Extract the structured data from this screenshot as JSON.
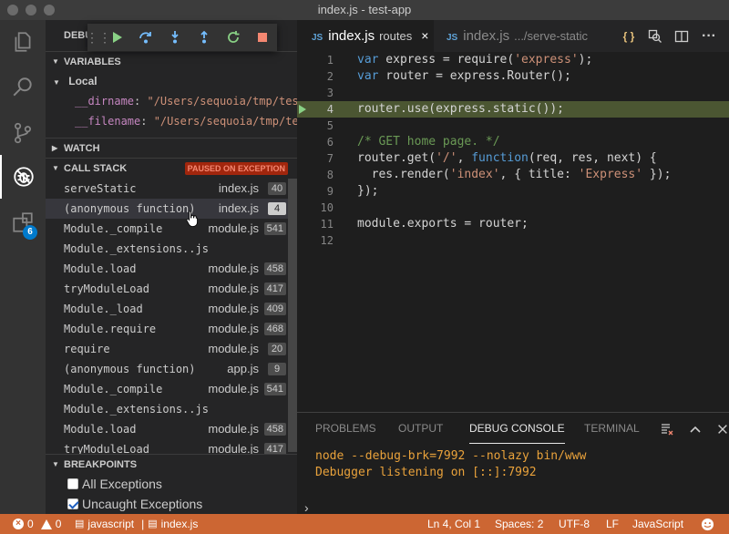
{
  "window": {
    "title": "index.js - test-app"
  },
  "activity_bar": {
    "extensions_badge": "6"
  },
  "debug": {
    "header_label": "DEBU",
    "toolbar_buttons": [
      "continue",
      "step-over",
      "step-into",
      "step-out",
      "restart",
      "stop"
    ]
  },
  "variables": {
    "header": "VARIABLES",
    "scope": "Local",
    "items": [
      {
        "name": "__dirname",
        "value": "\"/Users/sequoia/tmp/test-app/routes\""
      },
      {
        "name": "__filename",
        "value": "\"/Users/sequoia/tmp/test-app/routes/index.js\""
      }
    ]
  },
  "watch": {
    "header": "WATCH"
  },
  "call_stack": {
    "header": "CALL STACK",
    "status": "PAUSED ON EXCEPTION",
    "frames": [
      {
        "fn": "serveStatic",
        "file": "index.js",
        "line": "40"
      },
      {
        "fn": "(anonymous function)",
        "file": "index.js",
        "line": "4",
        "selected": true
      },
      {
        "fn": "Module._compile",
        "file": "module.js",
        "line": "541"
      },
      {
        "fn": "Module._extensions..js",
        "file": "",
        "line": ""
      },
      {
        "fn": "Module.load",
        "file": "module.js",
        "line": "458"
      },
      {
        "fn": "tryModuleLoad",
        "file": "module.js",
        "line": "417"
      },
      {
        "fn": "Module._load",
        "file": "module.js",
        "line": "409"
      },
      {
        "fn": "Module.require",
        "file": "module.js",
        "line": "468"
      },
      {
        "fn": "require",
        "file": "module.js",
        "line": "20"
      },
      {
        "fn": "(anonymous function)",
        "file": "app.js",
        "line": "9"
      },
      {
        "fn": "Module._compile",
        "file": "module.js",
        "line": "541"
      },
      {
        "fn": "Module._extensions..js",
        "file": "",
        "line": ""
      },
      {
        "fn": "Module.load",
        "file": "module.js",
        "line": "458"
      },
      {
        "fn": "tryModuleLoad",
        "file": "module.js",
        "line": "417"
      }
    ]
  },
  "breakpoints": {
    "header": "BREAKPOINTS",
    "items": [
      {
        "label": "All Exceptions",
        "checked": false
      },
      {
        "label": "Uncaught Exceptions",
        "checked": true
      }
    ]
  },
  "tabs": [
    {
      "icon": "JS",
      "name": "index.js",
      "desc": "routes",
      "close": "×",
      "active": true
    },
    {
      "icon": "JS",
      "name": "index.js",
      "desc": ".../serve-static",
      "active": false
    }
  ],
  "editor": {
    "current_line": 4,
    "lines": [
      {
        "n": "1",
        "tokens": [
          [
            "kw",
            "var"
          ],
          [
            "plain",
            " express = require("
          ],
          [
            "str",
            "'express'"
          ],
          [
            "plain",
            ");"
          ]
        ]
      },
      {
        "n": "2",
        "tokens": [
          [
            "kw",
            "var"
          ],
          [
            "plain",
            " router = express.Router();"
          ]
        ]
      },
      {
        "n": "3",
        "tokens": []
      },
      {
        "n": "4",
        "tokens": [
          [
            "plain",
            "router.use(express.static());"
          ]
        ]
      },
      {
        "n": "5",
        "tokens": []
      },
      {
        "n": "6",
        "tokens": [
          [
            "cmt",
            "/* GET home page. */"
          ]
        ]
      },
      {
        "n": "7",
        "tokens": [
          [
            "plain",
            "router.get("
          ],
          [
            "str",
            "'/'"
          ],
          [
            "plain",
            ", "
          ],
          [
            "kw",
            "function"
          ],
          [
            "plain",
            "(req, res, next) {"
          ]
        ]
      },
      {
        "n": "8",
        "tokens": [
          [
            "plain",
            "  res.render("
          ],
          [
            "str",
            "'index'"
          ],
          [
            "plain",
            ", { title: "
          ],
          [
            "str",
            "'Express'"
          ],
          [
            "plain",
            " });"
          ]
        ]
      },
      {
        "n": "9",
        "tokens": [
          [
            "plain",
            "});"
          ]
        ]
      },
      {
        "n": "10",
        "tokens": []
      },
      {
        "n": "11",
        "tokens": [
          [
            "plain",
            "module.exports = router;"
          ]
        ]
      },
      {
        "n": "12",
        "tokens": []
      }
    ]
  },
  "panel": {
    "tabs": [
      "PROBLEMS",
      "OUTPUT",
      "DEBUG CONSOLE",
      "TERMINAL"
    ],
    "active_tab": "DEBUG CONSOLE",
    "console": [
      "node --debug-brk=7992 --nolazy bin/www",
      "Debugger listening on [::]:7992"
    ],
    "prompt": "›"
  },
  "status_bar": {
    "errors": "0",
    "warnings": "0",
    "language_label": "javascript",
    "file": "index.js",
    "position": "Ln 4, Col 1",
    "spaces": "Spaces: 2",
    "encoding": "UTF-8",
    "eol": "LF",
    "language": "JavaScript"
  },
  "colors": {
    "status_bar": "#cc6633",
    "current_line": "#4b5632",
    "badge": "#007acc",
    "paused_badge": "#a1260d"
  }
}
